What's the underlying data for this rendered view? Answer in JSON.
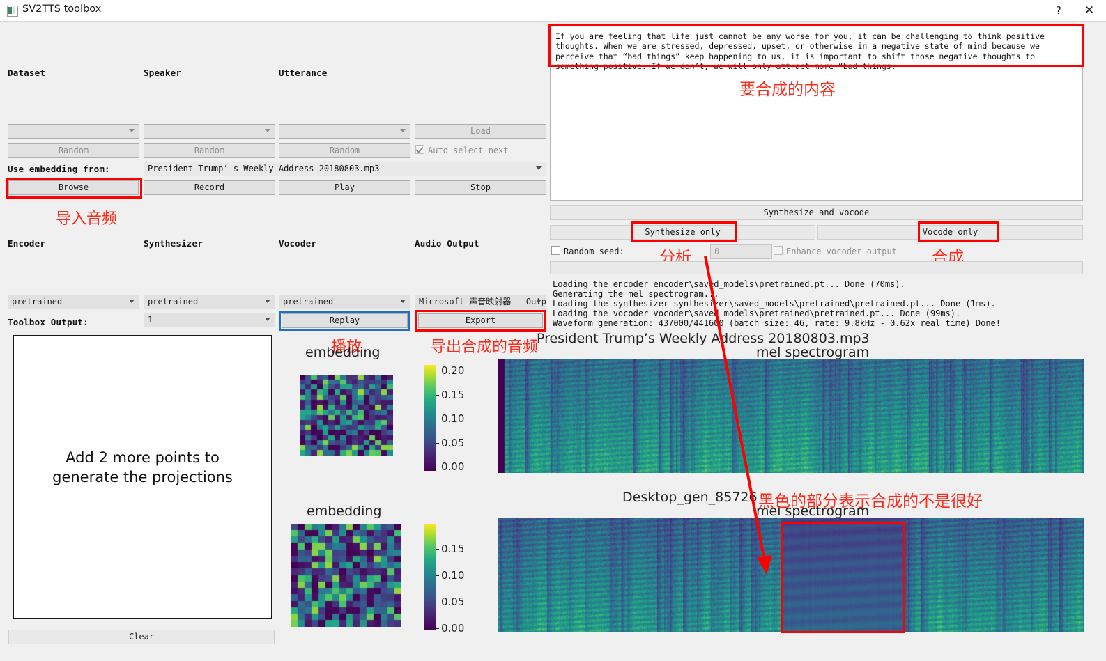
{
  "window": {
    "title": "SV2TTS toolbox",
    "help_label": "?",
    "close_label": "✕",
    "app_icon": "app-icon"
  },
  "browser": {
    "headers": {
      "dataset": "Dataset",
      "speaker": "Speaker",
      "utterance": "Utterance"
    },
    "dataset_value": "",
    "speaker_value": "",
    "utterance_value": "",
    "load_label": "Load",
    "random_dataset_label": "Random",
    "random_speaker_label": "Random",
    "random_utterance_label": "Random",
    "auto_select_next_label": "Auto select next",
    "auto_select_next_checked": true,
    "use_embedding_from_label": "Use embedding from:",
    "use_embedding_from_value": "President Trump’ s Weekly Address 20180803.mp3",
    "browse_label": "Browse",
    "record_label": "Record",
    "play_label": "Play",
    "stop_label": "Stop"
  },
  "models": {
    "headers": {
      "encoder": "Encoder",
      "synthesizer": "Synthesizer",
      "vocoder": "Vocoder",
      "audio_output": "Audio Output"
    },
    "encoder_value": "pretrained",
    "synthesizer_value": "pretrained",
    "vocoder_value": "pretrained",
    "audio_output_value": "Microsoft 声音映射器 - Outpu",
    "toolbox_output_label": "Toolbox Output:",
    "toolbox_output_value": "1",
    "replay_label": "Replay",
    "export_label": "Export"
  },
  "synthesis": {
    "text": "If you are feeling that life just cannot be any worse for you, it can be challenging to think positive thoughts. When we are stressed, depressed, upset, or otherwise in a negative state of mind because we perceive that “bad things” keep happening to us, it is important to shift those negative thoughts to something positive. If we don’t, we will only attract more “bad things.",
    "synthesize_and_vocode_label": "Synthesize and vocode",
    "synthesize_only_label": "Synthesize only",
    "vocode_only_label": "Vocode only",
    "random_seed_label": "Random seed:",
    "random_seed_checked": false,
    "seed_value": "0",
    "enhance_vocoder_output_label": "Enhance vocoder output",
    "enhance_vocoder_output_checked": false
  },
  "log": {
    "lines": [
      "Loading the encoder encoder\\saved_models\\pretrained.pt... Done (70ms).",
      "Generating the mel spectrogram...",
      "Loading the synthesizer synthesizer\\saved_models\\pretrained\\pretrained.pt... Done (1ms).",
      "Loading the vocoder vocoder\\saved_models\\pretrained\\pretrained.pt... Done (99ms).",
      "Waveform generation: 437000/441600 (batch size: 46, rate: 9.8kHz - 0.62x real time) Done!"
    ]
  },
  "projections": {
    "message_line1": "Add 2 more points to",
    "message_line2": "generate the projections",
    "clear_label": "Clear"
  },
  "plots": {
    "embedding_top_title": "embedding",
    "embedding_bottom_title": "embedding",
    "top_spectrogram_name": "President Trump’s Weekly Address 20180803.mp3",
    "top_spectrogram_subtitle": "mel spectrogram",
    "bottom_spectrogram_name": "Desktop_gen_85726",
    "bottom_spectrogram_subtitle": "mel spectrogram",
    "colorbar_top_ticks": [
      "0.20",
      "0.15",
      "0.10",
      "0.05",
      "0.00"
    ],
    "colorbar_bottom_ticks": [
      "0.15",
      "0.10",
      "0.05",
      "0.00"
    ]
  },
  "annotations": {
    "import_audio": "导入音频",
    "content_to_synthesize": "要合成的内容",
    "analyze": "分析",
    "synthesize": "合成",
    "play": "播放",
    "export_audio": "导出合成的音频",
    "black_part_note": "黑色的部分表示合成的不是很好"
  },
  "colors": {
    "annotation_red": "#ff2b1a",
    "highlight_box": "#ff0000",
    "replay_box": "#1f6fd0",
    "window_bg": "#f0f0f0"
  }
}
